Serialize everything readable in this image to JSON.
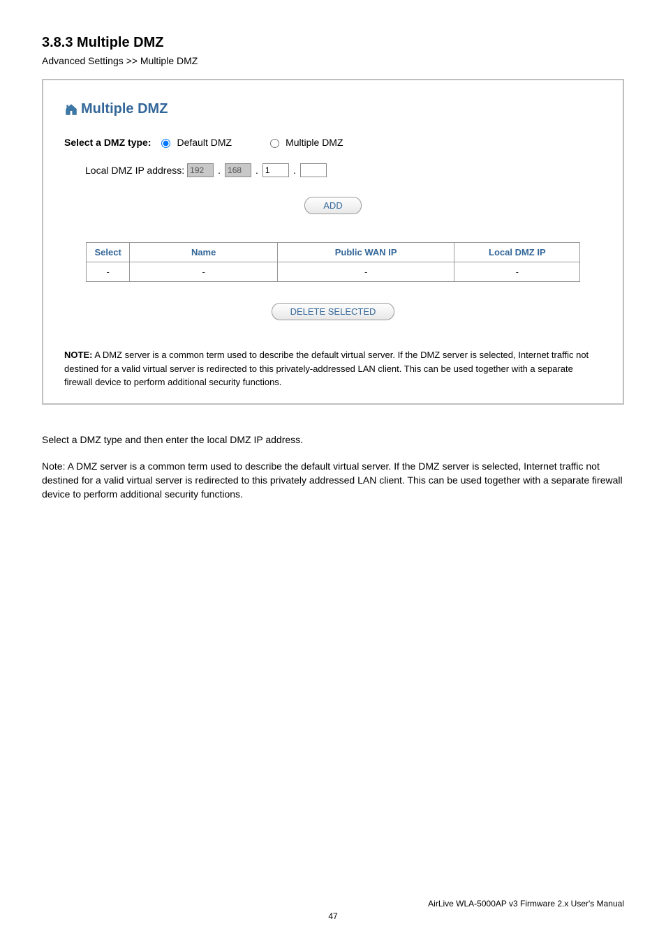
{
  "heading": "3.8.3 Multiple DMZ",
  "breadcrumb": "Advanced Settings >> Multiple DMZ",
  "panel": {
    "title": "Multiple DMZ",
    "select_label": "Select a DMZ type:",
    "radio_default": "Default DMZ",
    "radio_multiple": "Multiple DMZ",
    "ip_label": "Local DMZ IP address:",
    "ip": {
      "o1": "192",
      "o2": "168",
      "o3": "1",
      "o4": ""
    },
    "btn_add": "ADD",
    "btn_delete": "DELETE SELECTED",
    "table": {
      "headers": {
        "select": "Select",
        "name": "Name",
        "wan": "Public WAN IP",
        "local": "Local DMZ IP"
      },
      "row": {
        "select": "-",
        "name": "-",
        "wan": "-",
        "local": "-"
      }
    },
    "note_label": "NOTE:",
    "note_text": " A DMZ server is a common term used to describe the default virtual server. If the DMZ server is selected, Internet traffic not destined for a valid virtual server is redirected to this privately-addressed LAN client. This can be used together with a separate firewall device to perform additional security functions."
  },
  "body_p1": "Select a DMZ type and then enter the local DMZ IP address.",
  "body_p2": "Note: A DMZ server is a common term used to describe the default virtual server. If the DMZ server is selected, Internet traffic not destined for a valid virtual server is redirected to this privately addressed LAN client. This can be used together with a separate firewall device to perform additional security functions.",
  "footer": {
    "product": "AirLive WLA-5000AP v3 Firmware 2.x User's Manual",
    "page": "47"
  }
}
